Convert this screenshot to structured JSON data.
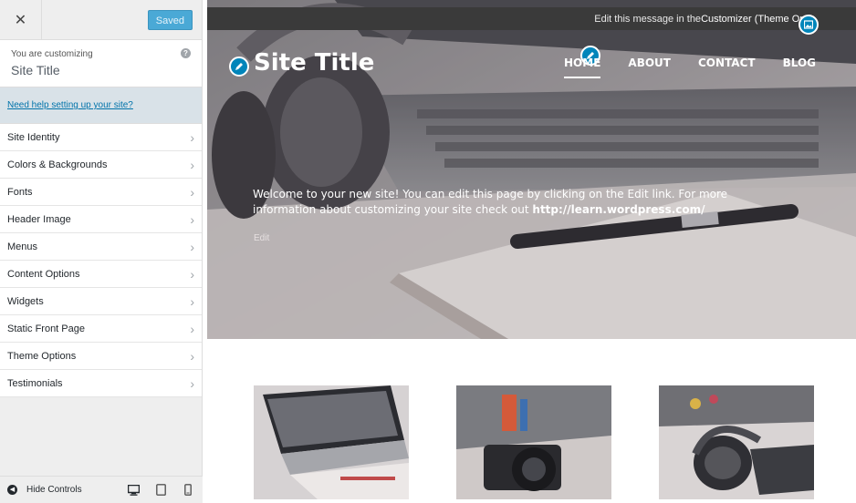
{
  "sidebar": {
    "saved_label": "Saved",
    "customizing_label": "You are customizing",
    "customizing_title": "Site Title",
    "help_link": "Need help setting up your site?",
    "panels": [
      {
        "label": "Site Identity"
      },
      {
        "label": "Colors & Backgrounds"
      },
      {
        "label": "Fonts"
      },
      {
        "label": "Header Image"
      },
      {
        "label": "Menus"
      },
      {
        "label": "Content Options"
      },
      {
        "label": "Widgets"
      },
      {
        "label": "Static Front Page"
      },
      {
        "label": "Theme Options"
      },
      {
        "label": "Testimonials"
      }
    ],
    "hide_controls": "Hide Controls"
  },
  "preview": {
    "notice_prefix": "Edit this message in the ",
    "notice_strong": "Customizer (Theme Optio",
    "site_title": "Site Title",
    "nav": [
      {
        "label": "HOME"
      },
      {
        "label": "ABOUT"
      },
      {
        "label": "CONTACT"
      },
      {
        "label": "BLOG"
      }
    ],
    "hero_text": "Welcome to your new site! You can edit this page by clicking on the Edit link. For more information about customizing your site check out ",
    "hero_link": "http://learn.wordpress.com/",
    "edit_label": "Edit"
  },
  "icons": {
    "close": "close-icon",
    "help": "help-icon",
    "chevron": "chevron-right-icon",
    "hide": "hide-controls-icon",
    "desktop": "desktop-icon",
    "tablet": "tablet-icon",
    "mobile": "mobile-icon",
    "edit": "pencil-icon",
    "image": "image-icon"
  },
  "colors": {
    "accent": "#0085ba",
    "saved_button": "#4aa9d6",
    "link": "#0073aa"
  }
}
